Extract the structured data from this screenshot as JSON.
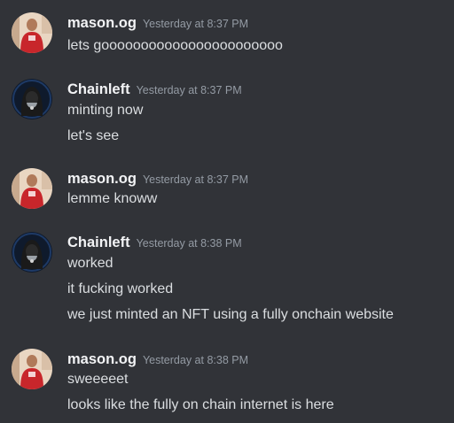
{
  "messages": [
    {
      "author": "mason.og",
      "timestamp": "Yesterday at 8:37 PM",
      "avatar": "person-red-shirt-avatar",
      "lines": [
        "lets gooooooooooooooooooooooo"
      ]
    },
    {
      "author": "Chainleft",
      "timestamp": "Yesterday at 8:37 PM",
      "avatar": "hooded-figure-avatar",
      "lines": [
        "minting now",
        "let's see"
      ]
    },
    {
      "author": "mason.og",
      "timestamp": "Yesterday at 8:37 PM",
      "avatar": "person-red-shirt-avatar",
      "lines": [
        "lemme knoww"
      ]
    },
    {
      "author": "Chainleft",
      "timestamp": "Yesterday at 8:38 PM",
      "avatar": "hooded-figure-avatar",
      "lines": [
        "worked",
        "it fucking worked",
        "we just minted an NFT using a fully onchain website"
      ]
    },
    {
      "author": "mason.og",
      "timestamp": "Yesterday at 8:38 PM",
      "avatar": "person-red-shirt-avatar",
      "lines": [
        "sweeeeet",
        "looks like the fully on chain internet is here"
      ]
    }
  ],
  "colors": {
    "background": "#313338",
    "username": "#f2f3f5",
    "timestamp": "#949ba4",
    "message_text": "#dbdee1"
  }
}
